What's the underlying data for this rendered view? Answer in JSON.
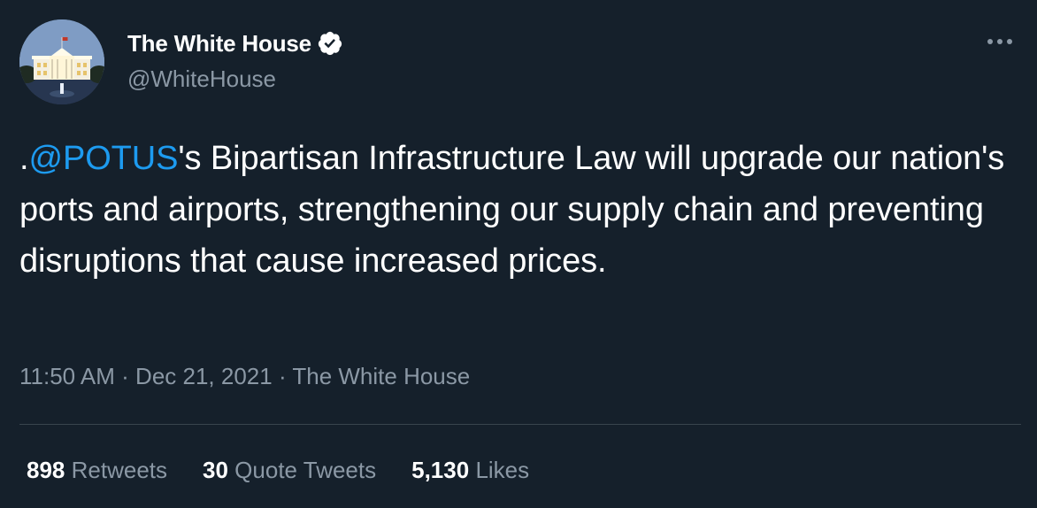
{
  "author": {
    "name": "The White House",
    "handle": "@WhiteHouse",
    "verified": true,
    "avatar_icon": "white-house-building-icon"
  },
  "tweet": {
    "prefix": ".",
    "mention": "@POTUS",
    "body": "'s Bipartisan Infrastructure Law will upgrade our nation's ports and airports, strengthening our supply chain and preventing disruptions that cause increased prices."
  },
  "meta": {
    "time": "11:50 AM",
    "date": "Dec 21, 2021",
    "source": "The White House",
    "separator": " · "
  },
  "stats": {
    "retweets": {
      "count": "898",
      "label": "Retweets"
    },
    "quote_tweets": {
      "count": "30",
      "label": "Quote Tweets"
    },
    "likes": {
      "count": "5,130",
      "label": "Likes"
    }
  },
  "icons": {
    "verified": "verified-badge-icon",
    "more": "more-options-icon"
  },
  "colors": {
    "background": "#15202b",
    "accent": "#1d9bf0",
    "secondary_text": "#8b98a5",
    "primary_text": "#ffffff"
  }
}
